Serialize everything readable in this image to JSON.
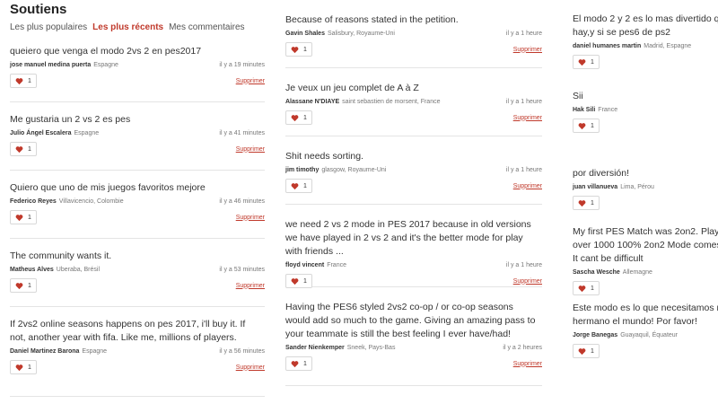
{
  "page": {
    "title": "Soutiens"
  },
  "tabs": [
    {
      "label": "Les plus populaires",
      "active": false
    },
    {
      "label": "Les plus récents",
      "active": true
    },
    {
      "label": "Mes commentaires",
      "active": false
    }
  ],
  "ui": {
    "delete_label": "Supprimer",
    "heart_color": "#c0392b",
    "accent": "#c0392b"
  },
  "columns": [
    [
      {
        "text": "queiero que venga el modo 2vs 2 en pes2017",
        "author": "jose manuel medina puerta",
        "place": "Espagne",
        "time": "il y a 19 minutes",
        "likes": "1"
      },
      {
        "text": "Me gustaria un 2 vs 2 es pes",
        "author": "Julio Ángel Escalera",
        "place": "Espagne",
        "time": "il y a 41 minutes",
        "likes": "1"
      },
      {
        "text": "Quiero que uno de mis juegos favoritos mejore",
        "author": "Federico Reyes",
        "place": "Villavicencio, Colombie",
        "time": "il y a 46 minutes",
        "likes": "1"
      },
      {
        "text": "The community wants it.",
        "author": "Matheus Alves",
        "place": "Uberaba, Brésil",
        "time": "il y a 53 minutes",
        "likes": "1"
      },
      {
        "text": "If 2vs2 online seasons happens on pes 2017, i'll buy it. If not, another year with fifa. Like me, millions of players.",
        "author": "Daniel Martinez Barona",
        "place": "Espagne",
        "time": "il y a 56 minutes",
        "likes": "1"
      }
    ],
    [
      {
        "text": "Because of reasons stated in the petition.",
        "author": "Gavin Shales",
        "place": "Salisbury, Royaume-Uni",
        "time": "il y a 1 heure",
        "likes": "1"
      },
      {
        "text": "Je veux un jeu complet de A à Z",
        "author": "Alassane N'DIAYE",
        "place": "saint sebastien de morsent, France",
        "time": "il y a 1 heure",
        "likes": "1"
      },
      {
        "text": "Shit needs sorting.",
        "author": "jim timothy",
        "place": "glasgow, Royaume-Uni",
        "time": "il y a 1 heure",
        "likes": "1"
      },
      {
        "text": "we need 2 vs 2 mode in PES 2017 because in old versions we have played in 2 vs 2 and it's the better mode for play with friends ...",
        "author": "floyd vincent",
        "place": "France",
        "time": "il y a 1 heure",
        "likes": "1"
      },
      {
        "text": "Having the PES6 styled 2vs2 co-op / or co-op seasons would add so much to the game. Giving an amazing pass to your teammate is still the best feeling I ever have/had!",
        "author": "Sander Nienkemper",
        "place": "Sneek, Pays-Bas",
        "time": "il y a 2 heures",
        "likes": "1"
      }
    ],
    [
      {
        "text": "El modo 2 y 2 es lo mas divertido que hay,y si se pes6 de ps2",
        "author": "daniel humanes martin",
        "place": "Madrid, Espagne",
        "time": "",
        "likes": "1"
      },
      {
        "text": "Sii",
        "author": "Hak Sili",
        "place": "France",
        "time": "",
        "likes": "1"
      },
      {
        "text": "por diversión!",
        "author": "juan villanueva",
        "place": "Lima, Pérou",
        "time": "",
        "likes": "1"
      },
      {
        "text": "My first PES Match was 2on2. Played over 1000 100% 2on2 Mode comes back. It cant be difficult",
        "author": "Sascha Wesche",
        "place": "Allemagne",
        "time": "",
        "likes": "1"
      },
      {
        "text": "Este modo es lo que necesitamos mi hermano el mundo! Por favor!",
        "author": "Jorge Banegas",
        "place": "Guayaquil, Équateur",
        "time": "",
        "likes": "1"
      }
    ]
  ]
}
